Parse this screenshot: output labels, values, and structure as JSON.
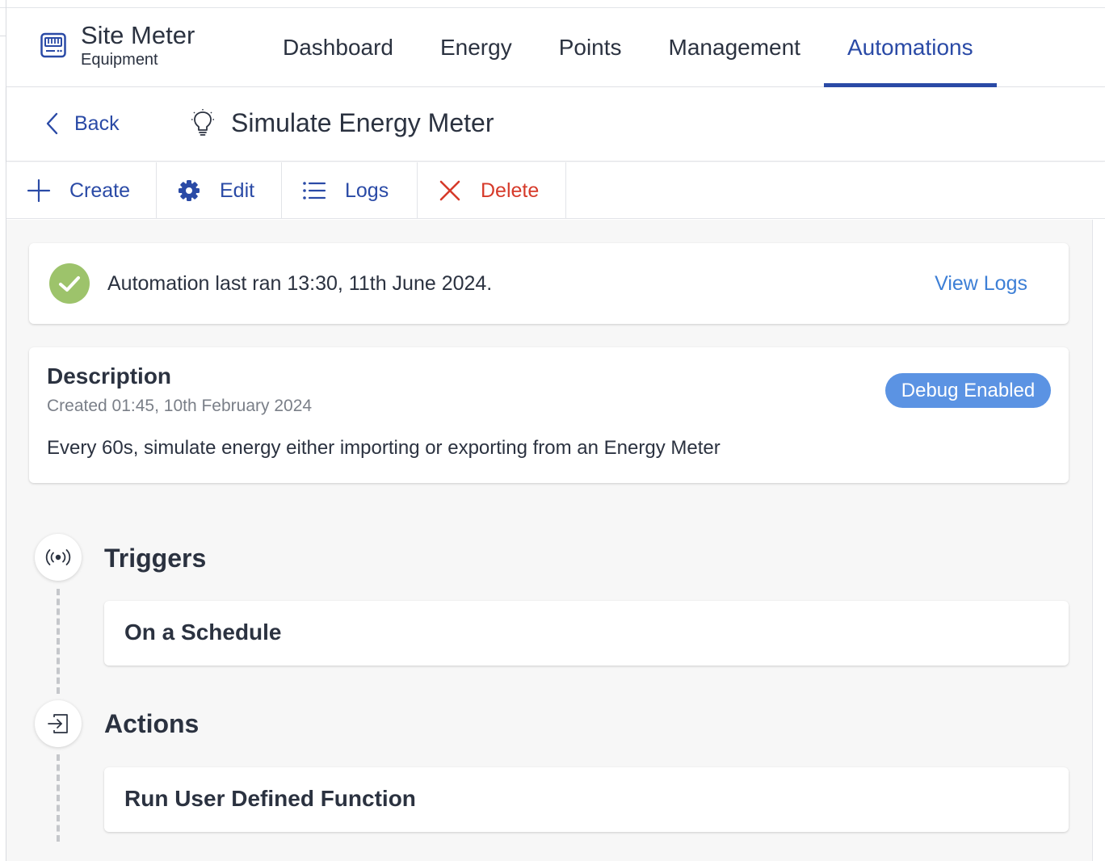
{
  "header": {
    "brand_title": "Site Meter",
    "brand_subtitle": "Equipment",
    "brand_icon": "meter-icon",
    "nav": [
      {
        "label": "Dashboard",
        "active": false
      },
      {
        "label": "Energy",
        "active": false
      },
      {
        "label": "Points",
        "active": false
      },
      {
        "label": "Management",
        "active": false
      },
      {
        "label": "Automations",
        "active": true
      }
    ]
  },
  "subheader": {
    "back_label": "Back",
    "page_title": "Simulate Energy Meter",
    "title_icon": "lightbulb-icon"
  },
  "toolbar": {
    "create_label": "Create",
    "edit_label": "Edit",
    "logs_label": "Logs",
    "delete_label": "Delete"
  },
  "status": {
    "text": "Automation last ran 13:30, 11th June 2024.",
    "view_logs_label": "View Logs",
    "icon": "check-circle-icon"
  },
  "description": {
    "title": "Description",
    "created": "Created 01:45, 10th February 2024",
    "body": "Every 60s, simulate energy either importing or exporting from an Energy Meter",
    "badge": "Debug Enabled"
  },
  "triggers": {
    "title": "Triggers",
    "icon": "broadcast-icon",
    "items": [
      "On a Schedule"
    ]
  },
  "actions": {
    "title": "Actions",
    "icon": "exit-icon",
    "items": [
      "Run User Defined Function"
    ]
  },
  "colors": {
    "accent": "#2a4aa6",
    "link": "#3d7fd6",
    "danger": "#d63a2a",
    "success": "#9dc36b",
    "badge": "#5b93e3"
  }
}
